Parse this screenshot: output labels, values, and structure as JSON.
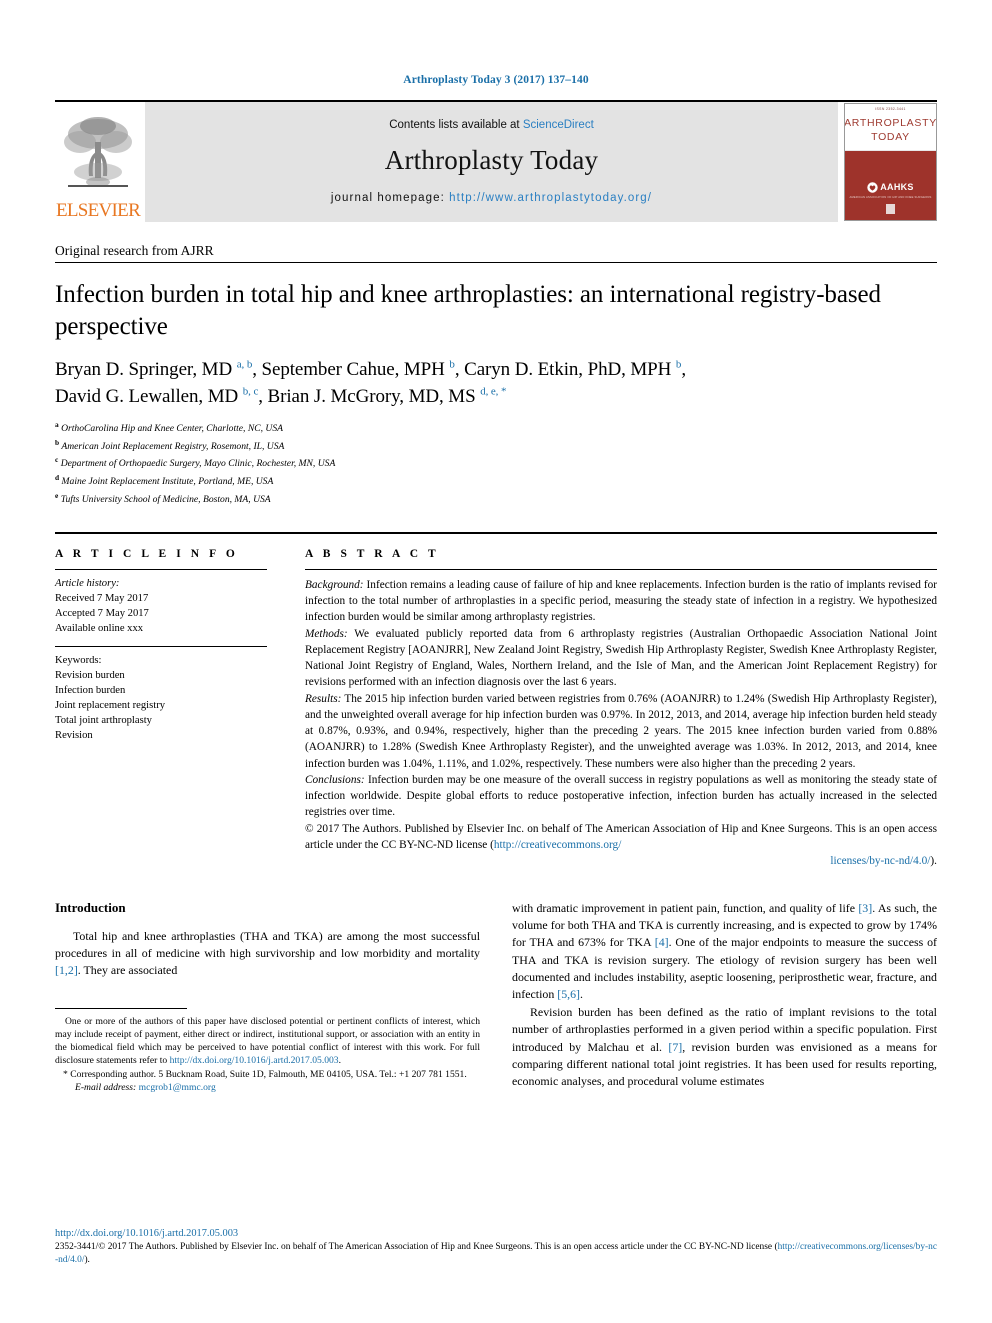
{
  "running_head": "Arthroplasty Today 3 (2017) 137–140",
  "masthead": {
    "publisher_name": "ELSEVIER",
    "contents_prefix": "Contents lists available at ",
    "contents_link": "ScienceDirect",
    "journal_name": "Arthroplasty Today",
    "homepage_label": "journal homepage: ",
    "homepage_url": "http://www.arthroplastytoday.org/",
    "cover": {
      "tiny_top": "ISSN 2352-3441",
      "title_line1": "ARTHROPLASTY",
      "title_line2": "TODAY",
      "society": "AAHKS",
      "society_sub": "AMERICAN ASSOCIATION OF HIP AND KNEE SURGEONS"
    }
  },
  "article": {
    "section_label": "Original research from AJRR",
    "title": "Infection burden in total hip and knee arthroplasties: an international registry-based perspective",
    "authors_html": "Bryan D. Springer, MD a, b, September Cahue, MPH b, Caryn D. Etkin, PhD, MPH b, David G. Lewallen, MD b, c, Brian J. McGrory, MD, MS d, e, *",
    "affiliations": [
      {
        "marker": "a",
        "text": "OrthoCarolina Hip and Knee Center, Charlotte, NC, USA"
      },
      {
        "marker": "b",
        "text": "American Joint Replacement Registry, Rosemont, IL, USA"
      },
      {
        "marker": "c",
        "text": "Department of Orthopaedic Surgery, Mayo Clinic, Rochester, MN, USA"
      },
      {
        "marker": "d",
        "text": "Maine Joint Replacement Institute, Portland, ME, USA"
      },
      {
        "marker": "e",
        "text": "Tufts University School of Medicine, Boston, MA, USA"
      }
    ]
  },
  "article_info": {
    "heading": "A R T I C L E   I N F O",
    "history_label": "Article history:",
    "received": "Received 7 May 2017",
    "accepted": "Accepted 7 May 2017",
    "available": "Available online xxx",
    "keywords_label": "Keywords:",
    "keywords": [
      "Revision burden",
      "Infection burden",
      "Joint replacement registry",
      "Total joint arthroplasty",
      "Revision"
    ]
  },
  "abstract": {
    "heading": "A B S T R A C T",
    "background_label": "Background:",
    "background_text": " Infection remains a leading cause of failure of hip and knee replacements. Infection burden is the ratio of implants revised for infection to the total number of arthroplasties in a specific period, measuring the steady state of infection in a registry. We hypothesized infection burden would be similar among arthroplasty registries.",
    "methods_label": "Methods:",
    "methods_text": " We evaluated publicly reported data from 6 arthroplasty registries (Australian Orthopaedic Association National Joint Replacement Registry [AOANJRR], New Zealand Joint Registry, Swedish Hip Arthroplasty Register, Swedish Knee Arthroplasty Register, National Joint Registry of England, Wales, Northern Ireland, and the Isle of Man, and the American Joint Replacement Registry) for revisions performed with an infection diagnosis over the last 6 years.",
    "results_label": "Results:",
    "results_text": " The 2015 hip infection burden varied between registries from 0.76% (AOANJRR) to 1.24% (Swedish Hip Arthroplasty Register), and the unweighted overall average for hip infection burden was 0.97%. In 2012, 2013, and 2014, average hip infection burden held steady at 0.87%, 0.93%, and 0.94%, respectively, higher than the preceding 2 years. The 2015 knee infection burden varied from 0.88% (AOANJRR) to 1.28% (Swedish Knee Arthroplasty Register), and the unweighted average was 1.03%. In 2012, 2013, and 2014, knee infection burden was 1.04%, 1.11%, and 1.02%, respectively. These numbers were also higher than the preceding 2 years.",
    "conclusions_label": "Conclusions:",
    "conclusions_text": " Infection burden may be one measure of the overall success in registry populations as well as monitoring the steady state of infection worldwide. Despite global efforts to reduce postoperative infection, infection burden has actually increased in the selected registries over time.",
    "copyright_text": "© 2017 The Authors. Published by Elsevier Inc. on behalf of The American Association of Hip and Knee Surgeons. This is an open access article under the CC BY-NC-ND license (",
    "copyright_link1": "http://creativecommons.org/",
    "copyright_link2": "licenses/by-nc-nd/4.0/",
    "copyright_tail": ")."
  },
  "introduction": {
    "heading": "Introduction",
    "para1_a": "Total hip and knee arthroplasties (THA and TKA) are among the most successful procedures in all of medicine with high survivorship and low morbidity and mortality ",
    "para1_ref1": "[1,2]",
    "para1_b": ". They are associated",
    "para1_cont_a": "with dramatic improvement in patient pain, function, and quality of life ",
    "para1_ref2": "[3]",
    "para1_cont_b": ". As such, the volume for both THA and TKA is currently increasing, and is expected to grow by 174% for THA and 673% for TKA ",
    "para1_ref3": "[4]",
    "para1_cont_c": ". One of the major endpoints to measure the success of THA and TKA is revision surgery. The etiology of revision surgery has been well documented and includes instability, aseptic loosening, periprosthetic wear, fracture, and infection ",
    "para1_ref4": "[5,6]",
    "para1_cont_d": ".",
    "para2_a": "Revision burden has been defined as the ratio of implant revisions to the total number of arthroplasties performed in a given period within a specific population. First introduced by Malchau et al. ",
    "para2_ref": "[7]",
    "para2_b": ", revision burden was envisioned as a means for comparing different national total joint registries. It has been used for results reporting, economic analyses, and procedural volume estimates"
  },
  "footnotes": {
    "disclosure": "One or more of the authors of this paper have disclosed potential or pertinent conflicts of interest, which may include receipt of payment, either direct or indirect, institutional support, or association with an entity in the biomedical field which may be perceived to have potential conflict of interest with this work. For full disclosure statements refer to ",
    "disclosure_link": "http://dx.doi.org/10.1016/j.artd.2017.05.003",
    "disclosure_tail": ".",
    "corresponding": "* Corresponding author. 5 Bucknam Road, Suite 1D, Falmouth, ME 04105, USA. Tel.: +1 207 781 1551.",
    "email_label": "E-mail address:",
    "email": "mcgrob1@mmc.org"
  },
  "page_footer": {
    "doi": "http://dx.doi.org/10.1016/j.artd.2017.05.003",
    "text_a": "2352-3441/© 2017 The Authors. Published by Elsevier Inc. on behalf of The American Association of Hip and Knee Surgeons. This is an open access article under the CC BY-NC-ND license (",
    "link": "http://creativecommons.org/licenses/by-nc-nd/4.0/",
    "text_b": ")."
  },
  "colors": {
    "link_blue": "#1a6fa8",
    "sciencedirect_blue": "#2a7fc2",
    "elsevier_orange": "#E87722",
    "cover_red": "#9e332b",
    "band_gray": "#e3e3e3"
  }
}
